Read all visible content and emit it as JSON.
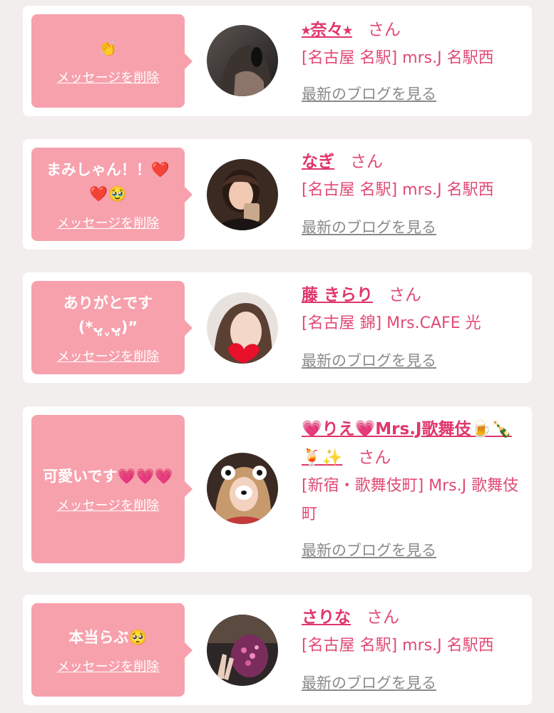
{
  "cards": [
    {
      "message": "👏",
      "delete_label": "メッセージを削除",
      "name": "⭑奈々⭑",
      "honorific": "さん",
      "shop": "[名古屋 名駅] mrs.J 名駅西",
      "blog_link": "最新のブログを見る"
    },
    {
      "message": "まみしゃん！！❤️❤️🥹",
      "delete_label": "メッセージを削除",
      "name": "なぎ",
      "honorific": "さん",
      "shop": "[名古屋 名駅] mrs.J 名駅西",
      "blog_link": "最新のブログを見る"
    },
    {
      "message": "ありがとです(*ᴗ͈ˬᴗ͈)”",
      "delete_label": "メッセージを削除",
      "name": "藤 きらり",
      "honorific": "さん",
      "shop": "[名古屋 錦] Mrs.CAFE 光",
      "blog_link": "最新のブログを見る"
    },
    {
      "message": "可愛いです💗💗💗",
      "delete_label": "メッセージを削除",
      "name": "💗りえ💗Mrs.J歌舞伎🍺🍾🍹✨",
      "honorific": "さん",
      "shop": "[新宿・歌舞伎町] Mrs.J 歌舞伎町",
      "blog_link": "最新のブログを見る"
    },
    {
      "message": "本当らぶ🥺",
      "delete_label": "メッセージを削除",
      "name": "さりな",
      "honorific": "さん",
      "shop": "[名古屋 名駅] mrs.J 名駅西",
      "blog_link": "最新のブログを見る"
    }
  ]
}
